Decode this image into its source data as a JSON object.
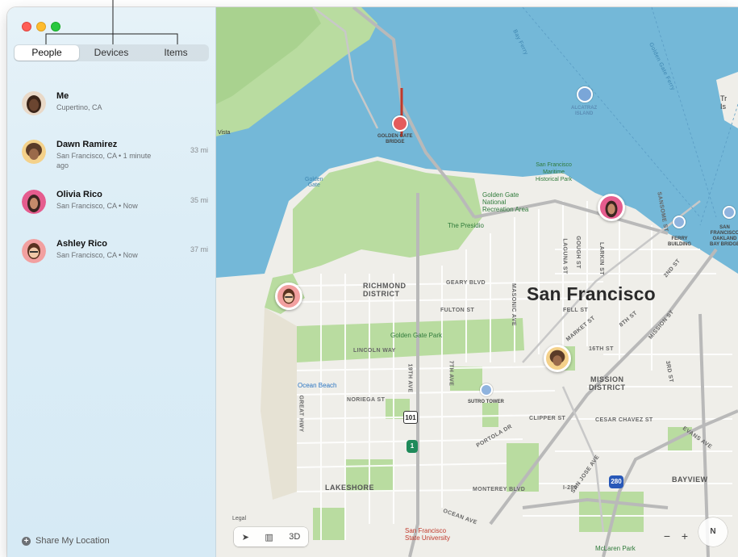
{
  "sidebar": {
    "tabs": [
      {
        "label": "People",
        "active": true
      },
      {
        "label": "Devices",
        "active": false
      },
      {
        "label": "Items",
        "active": false
      }
    ],
    "people": [
      {
        "name": "Me",
        "location": "Cupertino, CA",
        "distance": ""
      },
      {
        "name": "Dawn Ramirez",
        "location": "San Francisco, CA • 1 minute ago",
        "distance": "33 mi"
      },
      {
        "name": "Olivia Rico",
        "location": "San Francisco, CA • Now",
        "distance": "35 mi"
      },
      {
        "name": "Ashley Rico",
        "location": "San Francisco, CA • Now",
        "distance": "37 mi"
      }
    ],
    "share_label": "Share My Location"
  },
  "map": {
    "city": "San Francisco",
    "districts": {
      "richmond": "RICHMOND\nDISTRICT",
      "mission": "MISSION\nDISTRICT",
      "lakeshore": "LAKESHORE",
      "bayview": "BAYVIEW"
    },
    "streets": {
      "geary": "GEARY BLVD",
      "fulton": "FULTON ST",
      "lincoln": "LINCOLN WAY",
      "noriega": "NORIEGA ST",
      "clipper": "CLIPPER ST",
      "cesar": "CESAR CHAVEZ ST",
      "monterey": "MONTEREY BLVD",
      "portola": "PORTOLA DR",
      "ocean": "OCEAN AVE",
      "great": "GREAT HWY",
      "market": "MARKET ST",
      "mission_st": "MISSION ST",
      "fell": "FELL ST",
      "sixteenth": "16TH ST",
      "masonic": "MASONIC AVE",
      "seventh": "7TH AVE",
      "nineteenth": "19TH AVE",
      "gough": "GOUGH ST",
      "laguna": "LAGUNA ST",
      "larkin": "LARKIN ST",
      "sansome": "SANSOME ST",
      "third": "3RD ST",
      "eighth": "8TH ST",
      "second": "2ND ST",
      "sanjose": "SAN JOSE AVE",
      "evans": "EVANS AVE",
      "i280": "I-280",
      "bay_ferry": "Bay Ferry",
      "golden_gate_ferry": "Golden Gate Ferry"
    },
    "pois": {
      "golden_gate_bridge": "GOLDEN GATE\nBRIDGE",
      "alcatraz": "ALCATRAZ\nISLAND",
      "maritime": "San Francisco\nMaritime\nHistorical Park",
      "recreation": "Golden Gate\nNational\nRecreation Area",
      "presidio": "The Presidio",
      "ggpark": "Golden Gate Park",
      "ocean_beach": "Ocean Beach",
      "sutro": "SUTRO TOWER",
      "ferry": "FERRY\nBUILDING",
      "oakland_bridge": "SAN\nFRANCISCO\nOAKLAND\nBAY BRIDGE",
      "sfsu": "San Francisco\nState University",
      "mclaren": "McLaren Park",
      "golden_gate_water": "Golden\nGate",
      "vista": "Vista",
      "tr": "Tr\nIs"
    },
    "highways": {
      "h101": "101",
      "h1": "1",
      "h280": "280"
    },
    "controls": {
      "legal": "Legal",
      "location_icon": "location-arrow-icon",
      "map_icon": "map-icon",
      "three_d": "3D",
      "zoom_out": "−",
      "zoom_in": "+",
      "compass": "N"
    }
  },
  "colors": {
    "water": "#74b8d8",
    "land": "#efeee9",
    "park": "#b9dca0",
    "road": "#ffffff",
    "highway": "#b4b4b4"
  }
}
